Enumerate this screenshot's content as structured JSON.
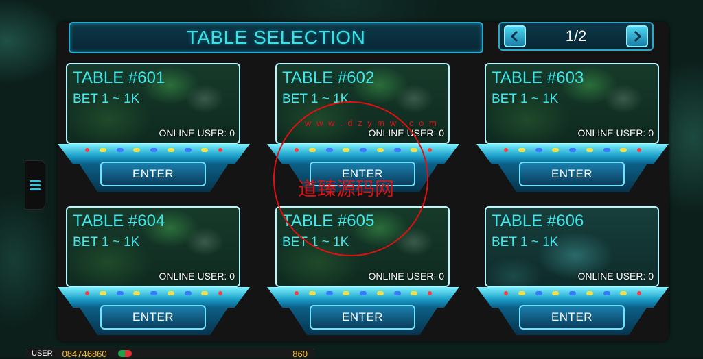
{
  "header": {
    "title": "TABLE SELECTION",
    "page_indicator": "1/2",
    "prev_icon": "chevron-left-icon",
    "next_icon": "chevron-right-icon"
  },
  "side_menu_icon": "hamburger-icon",
  "tables": [
    {
      "name": "TABLE  #601",
      "bet": "BET   1 ~ 1K",
      "online": "ONLINE USER: 0",
      "enter": "ENTER"
    },
    {
      "name": "TABLE  #602",
      "bet": "BET   1 ~ 1K",
      "online": "ONLINE USER: 0",
      "enter": "ENTER"
    },
    {
      "name": "TABLE  #603",
      "bet": "BET   1 ~ 1K",
      "online": "ONLINE USER: 0",
      "enter": "ENTER"
    },
    {
      "name": "TABLE  #604",
      "bet": "BET   1 ~ 1K",
      "online": "ONLINE USER: 0",
      "enter": "ENTER"
    },
    {
      "name": "TABLE  #605",
      "bet": "BET   1 ~ 1K",
      "online": "ONLINE USER: 0",
      "enter": "ENTER"
    },
    {
      "name": "TABLE  #606",
      "bet": "BET   1 ~ 1K",
      "online": "ONLINE USER: 0",
      "enter": "ENTER"
    }
  ],
  "status_bar": {
    "user_label": "USER",
    "user_id": "084746860",
    "credit": "860"
  },
  "watermark": {
    "text": "道臻源码网",
    "url": "w w w . d z y m w . c o m"
  },
  "colors": {
    "accent": "#39e0e8",
    "gold": "#f4c02a",
    "watermark": "#e01010"
  }
}
